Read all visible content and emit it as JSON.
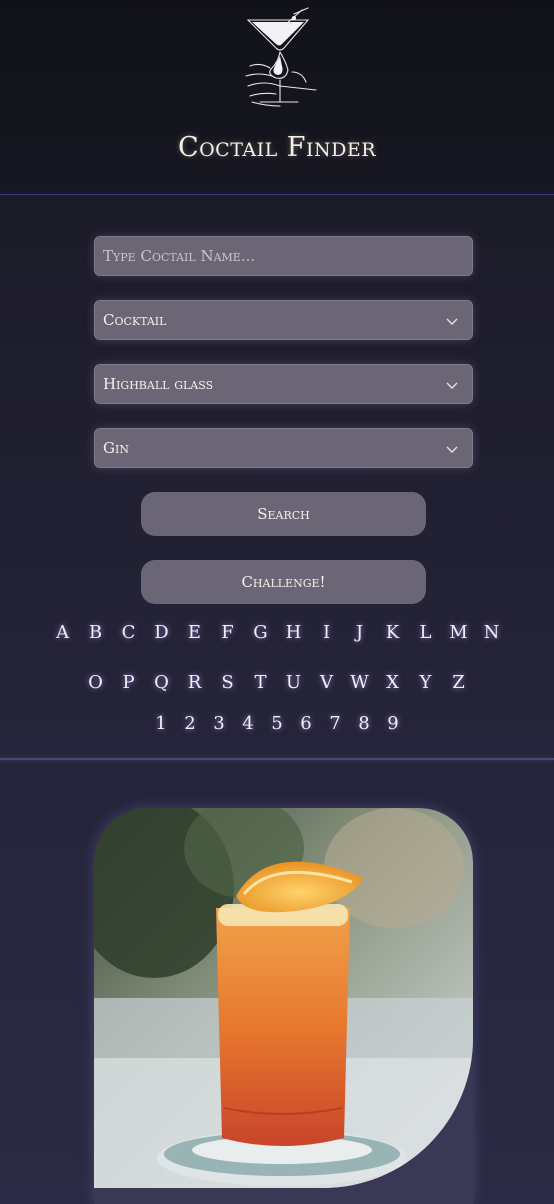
{
  "header": {
    "title": "Coctail Finder",
    "logo_icon": "martini-glass-icon"
  },
  "search": {
    "name_placeholder": "Type Coctail Name...",
    "category_selected": "Cocktail",
    "glass_selected": "Highball glass",
    "ingredient_selected": "Gin",
    "search_label": "Search",
    "challenge_label": "Challenge!"
  },
  "alphabet": {
    "row1": [
      "A",
      "B",
      "C",
      "D",
      "E",
      "F",
      "G",
      "H",
      "I",
      "J",
      "K",
      "L",
      "M",
      "N"
    ],
    "row2": [
      "O",
      "P",
      "Q",
      "R",
      "S",
      "T",
      "U",
      "V",
      "W",
      "X",
      "Y",
      "Z"
    ],
    "digits": [
      "1",
      "2",
      "3",
      "4",
      "5",
      "6",
      "7",
      "8",
      "9"
    ]
  },
  "result": {
    "image_icon": "cocktail-photo"
  },
  "colors": {
    "background": "#1c1b28",
    "field": "#6b6675",
    "glow": "#c8aaff",
    "text": "#f3ece0"
  }
}
